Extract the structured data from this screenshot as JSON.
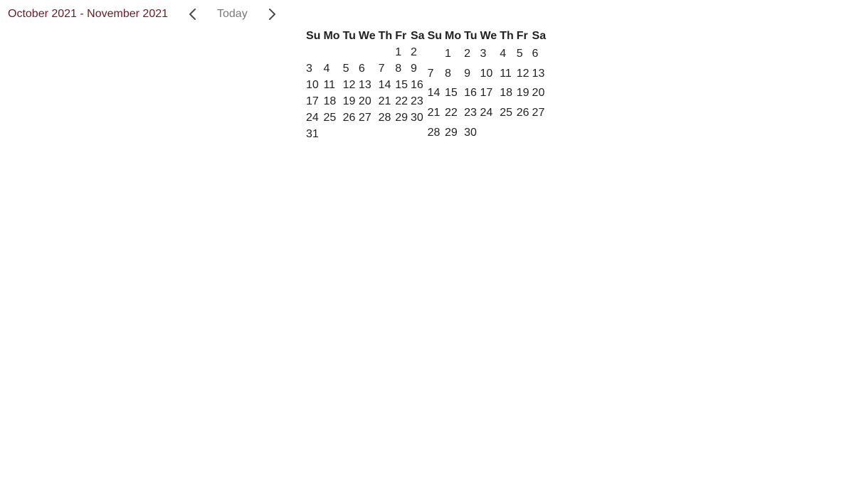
{
  "toolbar": {
    "range_title": "October 2021 - November 2021",
    "today_label": "Today",
    "prev_icon": "chevron-left-icon",
    "next_icon": "chevron-right-icon"
  },
  "colors": {
    "title": "#6b1a26",
    "today": "#7a7a7a",
    "icon": "#4a4a4a"
  },
  "weekdays": [
    "Su",
    "Mo",
    "Tu",
    "We",
    "Th",
    "Fr",
    "Sa"
  ],
  "months": [
    {
      "name": "October 2021",
      "weeks": [
        [
          "",
          "",
          "",
          "",
          "",
          "1",
          "2"
        ],
        [
          "3",
          "4",
          "5",
          "6",
          "7",
          "8",
          "9"
        ],
        [
          "10",
          "11",
          "12",
          "13",
          "14",
          "15",
          "16"
        ],
        [
          "17",
          "18",
          "19",
          "20",
          "21",
          "22",
          "23"
        ],
        [
          "24",
          "25",
          "26",
          "27",
          "28",
          "29",
          "30"
        ],
        [
          "31",
          "",
          "",
          "",
          "",
          "",
          ""
        ]
      ]
    },
    {
      "name": "November 2021",
      "weeks": [
        [
          "",
          "1",
          "2",
          "3",
          "4",
          "5",
          "6"
        ],
        [
          "7",
          "8",
          "9",
          "10",
          "11",
          "12",
          "13"
        ],
        [
          "14",
          "15",
          "16",
          "17",
          "18",
          "19",
          "20"
        ],
        [
          "21",
          "22",
          "23",
          "24",
          "25",
          "26",
          "27"
        ],
        [
          "28",
          "29",
          "30",
          "",
          "",
          "",
          ""
        ]
      ]
    }
  ]
}
